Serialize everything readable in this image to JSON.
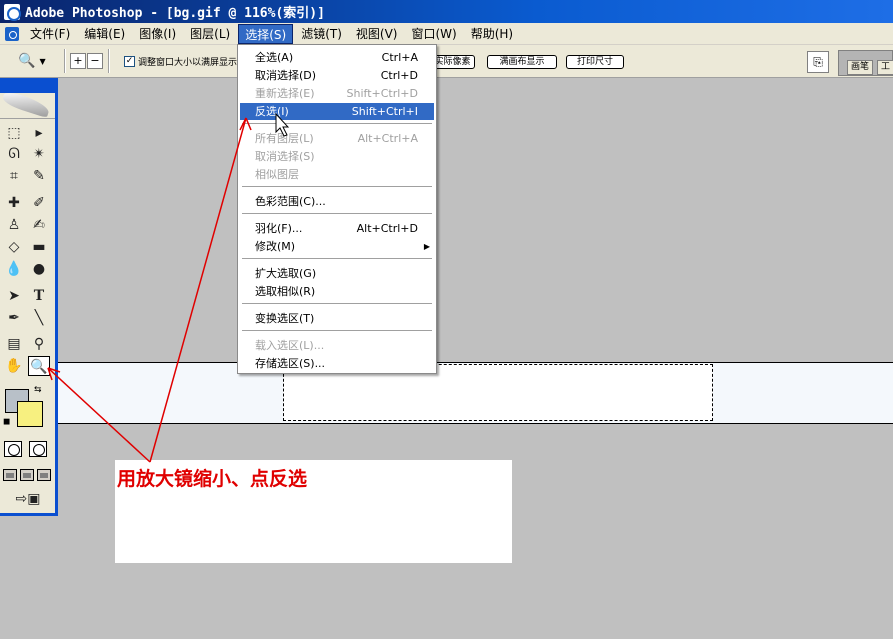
{
  "window": {
    "title": "Adobe Photoshop - [bg.gif @ 116%(索引)]"
  },
  "menubar": {
    "items": [
      {
        "label": "文件(F)"
      },
      {
        "label": "编辑(E)"
      },
      {
        "label": "图像(I)"
      },
      {
        "label": "图层(L)"
      },
      {
        "label": "选择(S)",
        "active": true
      },
      {
        "label": "滤镜(T)"
      },
      {
        "label": "视图(V)"
      },
      {
        "label": "窗口(W)"
      },
      {
        "label": "帮助(H)"
      }
    ]
  },
  "options_bar": {
    "tool_icon": "zoom-icon",
    "resize_window_checked": true,
    "resize_window_label": "调整窗口大小以满屏显示",
    "buttons": {
      "actual_pixels": "实际像素",
      "fit_on_screen": "满画布显示",
      "print_size": "打印尺寸"
    },
    "palette_tabs": [
      "画笔",
      "工"
    ]
  },
  "select_menu": {
    "items": [
      {
        "label": "全选(A)",
        "shortcut": "Ctrl+A",
        "disabled": false
      },
      {
        "label": "取消选择(D)",
        "shortcut": "Ctrl+D",
        "disabled": false
      },
      {
        "label": "重新选择(E)",
        "shortcut": "Shift+Ctrl+D",
        "disabled": true
      },
      {
        "label": "反选(I)",
        "shortcut": "Shift+Ctrl+I",
        "disabled": false,
        "highlighted": true
      },
      {
        "label": "所有图层(L)",
        "shortcut": "Alt+Ctrl+A",
        "disabled": true
      },
      {
        "label": "取消选择(S)",
        "shortcut": "",
        "disabled": true
      },
      {
        "label": "相似图层",
        "shortcut": "",
        "disabled": true
      },
      {
        "label": "色彩范围(C)...",
        "shortcut": "",
        "disabled": false
      },
      {
        "label": "羽化(F)...",
        "shortcut": "Alt+Ctrl+D",
        "disabled": false
      },
      {
        "label": "修改(M)",
        "shortcut": "",
        "disabled": false,
        "submenu": true
      },
      {
        "label": "扩大选取(G)",
        "shortcut": "",
        "disabled": false
      },
      {
        "label": "选取相似(R)",
        "shortcut": "",
        "disabled": false
      },
      {
        "label": "变换选区(T)",
        "shortcut": "",
        "disabled": false
      },
      {
        "label": "载入选区(L)...",
        "shortcut": "",
        "disabled": true
      },
      {
        "label": "存储选区(S)...",
        "shortcut": "",
        "disabled": false
      }
    ]
  },
  "toolbox": {
    "tools": [
      "rect-marquee",
      "move",
      "lasso",
      "magic-wand",
      "crop",
      "slice",
      "healing-brush",
      "brush",
      "clone-stamp",
      "history-brush",
      "eraser",
      "gradient",
      "blur",
      "dodge",
      "path-selection",
      "type",
      "pen",
      "line",
      "notes",
      "eyedropper",
      "hand",
      "zoom"
    ],
    "selected_tool": "zoom",
    "foreground_color": "#b8c0c8",
    "background_color": "#f7f080"
  },
  "annotation": {
    "text": "用放大镜缩小、点反选",
    "color": "#e00000"
  },
  "colors": {
    "title_bar": "#0a4fd0",
    "menu_highlight": "#316ac5",
    "workspace": "#c0c0c0"
  }
}
